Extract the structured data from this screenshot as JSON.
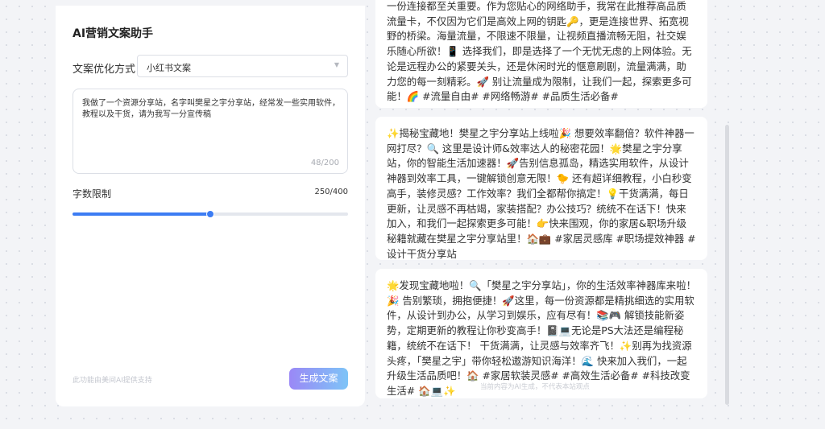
{
  "panel": {
    "title": "AI营销文案助手",
    "optimize_label": "文案优化方式",
    "optimize_value": "小红书文案",
    "prompt_text": "我做了一个资源分享站，名字叫樊星之宇分享站，经常发一些实用软件，教程以及干货，请为我写一分宣传稿",
    "prompt_count": "48/200",
    "limit_label": "字数限制",
    "limit_value": "250/400",
    "limit_fraction": 0.5,
    "footer_note": "此功能由美间AI提供支持",
    "generate_label": "生成文案"
  },
  "results": [
    "一份连接都至关重要。作为您贴心的网络助手，我常在此推荐高品质流量卡，不仅因为它们是高效上网的钥匙🔑，更是连接世界、拓宽视野的桥梁。海量流量，不限速不限量，让视频直播流畅无阻，社交娱乐随心所欲！📱 选择我们，即是选择了一个无忧无虑的上网体验。无论是远程办公的紧要关头，还是休闲时光的惬意刷剧，流量满满，助力您的每一刻精彩。🚀 别让流量成为限制，让我们一起，探索更多可能！🌈 #流量自由# #网络畅游# #品质生活必备#",
    "✨揭秘宝藏地！樊星之宇分享站上线啦🎉 想要效率翻倍？软件神器一网打尽？🔍 这里是设计师&效率达人的秘密花园！🌟樊星之宇分享站，你的智能生活加速器！🚀告别信息孤岛，精选实用软件，从设计神器到效率工具，一键解锁创意无限！🐤 还有超详细教程，小白秒变高手，装修灵感？工作效率？我们全都帮你搞定！💡干货满满，每日更新，让灵感不再枯竭，家装搭配？办公技巧？统统不在话下！快来加入，和我们一起探索更多可能！👉快来围观，你的家居&职场升级秘籍就藏在樊星之宇分享站里！🏠💼 #家居灵感库 #职场提效神器 #设计干货分享站",
    "🌟发现宝藏地啦！🔍「樊星之宇分享站」，你的生活效率神器库来啦！🎉 告别繁琐，拥抱便捷！🚀这里，每一份资源都是精挑细选的实用软件，从设计到办公，从学习到娱乐，应有尽有！📚🎮 解锁技能新姿势，定期更新的教程让你秒变高手！📓💻无论是PS大法还是编程秘籍，统统不在话下！ 干货满满，让灵感与效率齐飞！✨别再为找资源头疼，「樊星之宇」带你轻松遨游知识海洋！🌊 快来加入我们，一起升级生活品质吧！🏠 #家居软装灵感# #高效生活必备# #科技改变生活# 🏠💻✨"
  ],
  "disclaimer": "当前内容为AI生成，不代表本站观点",
  "colors": {
    "accent": "#3c7cf3",
    "button_gradient": [
      "#9a88f6",
      "#7ec4f7"
    ]
  },
  "icons": {
    "select_caret": "chevron-down-icon"
  }
}
